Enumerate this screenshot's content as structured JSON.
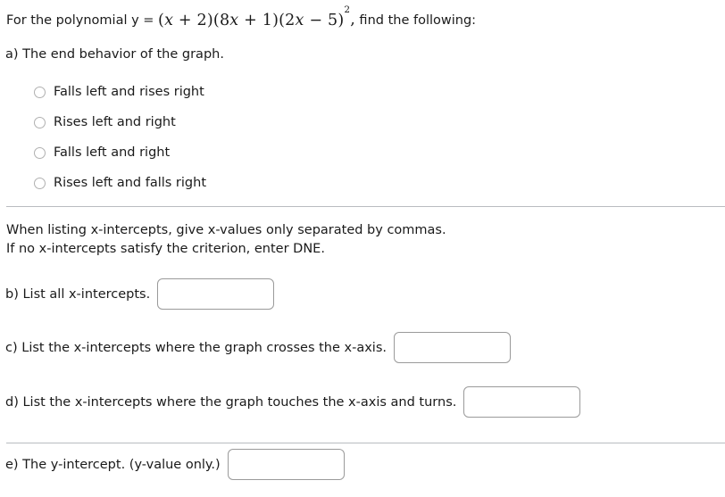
{
  "prompt": {
    "lead": "For the polynomial y = ",
    "expression_plain": "(x + 2)(8x + 1)(2x − 5)²",
    "factor1_open": "(",
    "factor1_var": "x",
    "factor1_op": " + ",
    "factor1_const": "2",
    "factor1_close": ")",
    "factor2_open": "(",
    "factor2_coef": "8",
    "factor2_var": "x",
    "factor2_op": " + ",
    "factor2_const": "1",
    "factor2_close": ")",
    "factor3_open": "(",
    "factor3_coef": "2",
    "factor3_var": "x",
    "factor3_op": " − ",
    "factor3_const": "5",
    "factor3_close": ")",
    "factor3_exponent": "2",
    "comma": ",",
    "trail": " find the following:"
  },
  "part_a": {
    "label": "a) The end behavior of the graph.",
    "options": [
      {
        "label": "Falls left and rises right",
        "selected": false
      },
      {
        "label": "Rises left and right",
        "selected": false
      },
      {
        "label": "Falls left and right",
        "selected": false
      },
      {
        "label": "Rises left and falls right",
        "selected": false
      }
    ]
  },
  "instructions": {
    "line1": "When listing x-intercepts, give x-values only separated by commas.",
    "line2": "If no x-intercepts satisfy the criterion, enter DNE."
  },
  "questions": [
    {
      "id": "b",
      "label": "b) List all x-intercepts.",
      "value": "",
      "placeholder": ""
    },
    {
      "id": "c",
      "label": "c) List the x-intercepts where the graph crosses the x-axis.",
      "value": "",
      "placeholder": ""
    },
    {
      "id": "d",
      "label": "d) List the x-intercepts where the graph touches the x-axis and turns.",
      "value": "",
      "placeholder": ""
    },
    {
      "id": "e",
      "label": "e) The y-intercept. (y-value only.)",
      "value": "",
      "placeholder": ""
    }
  ],
  "colors": {
    "text": "#1a1a1a",
    "divider": "#b9bcc0",
    "input_border": "#9a9a9a",
    "radio_border": "#b0b0b0",
    "background": "#ffffff"
  }
}
